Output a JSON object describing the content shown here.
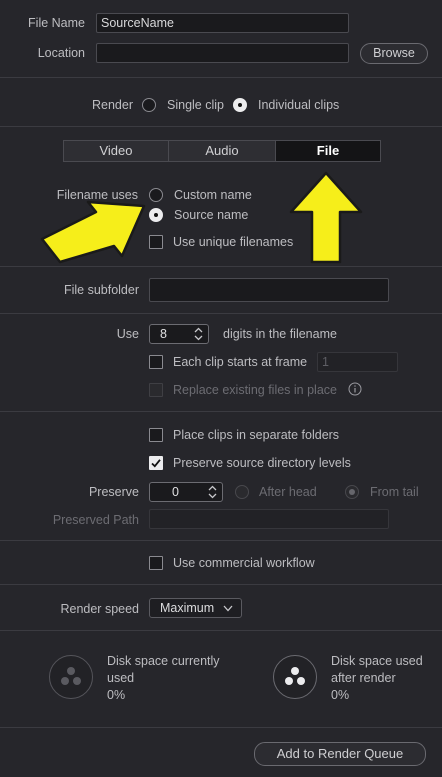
{
  "file_name": {
    "label": "File Name",
    "value": "SourceName"
  },
  "location": {
    "label": "Location",
    "value": "",
    "browse_label": "Browse"
  },
  "render": {
    "label": "Render",
    "single_clip": "Single clip",
    "individual_clips": "Individual clips",
    "selected": "individual_clips"
  },
  "tabs": [
    {
      "label": "Video",
      "active": false
    },
    {
      "label": "Audio",
      "active": false
    },
    {
      "label": "File",
      "active": true
    }
  ],
  "filename_uses": {
    "label": "Filename uses",
    "custom_name": "Custom name",
    "source_name": "Source name",
    "selected": "source_name",
    "unique_label": "Use unique filenames",
    "unique_checked": false
  },
  "file_subfolder": {
    "label": "File subfolder",
    "value": ""
  },
  "use_digits": {
    "label": "Use",
    "value": "8",
    "suffix": "digits in the filename"
  },
  "each_clip_starts": {
    "label": "Each clip starts at frame",
    "checked": false,
    "value": "1"
  },
  "replace_existing": {
    "label": "Replace existing files in place",
    "checked": false,
    "enabled": false
  },
  "separate_folders": {
    "label": "Place clips in separate folders",
    "checked": false
  },
  "preserve_source": {
    "label": "Preserve source directory levels",
    "checked": true
  },
  "preserve": {
    "label": "Preserve",
    "value": "0",
    "after_head": "After head",
    "from_tail": "From tail",
    "selected": "from_tail"
  },
  "preserved_path": {
    "label": "Preserved Path",
    "value": ""
  },
  "commercial_workflow": {
    "label": "Use commercial workflow",
    "checked": false
  },
  "render_speed": {
    "label": "Render speed",
    "value": "Maximum"
  },
  "disk_current": {
    "line1": "Disk space currently",
    "line2": "used",
    "percent": "0%"
  },
  "disk_after": {
    "line1": "Disk space used",
    "line2": "after render",
    "percent": "0%"
  },
  "add_to_queue": {
    "label": "Add to Render Queue"
  },
  "colors": {
    "background": "#26262b",
    "annotation_arrow": "#f6ee1a"
  }
}
